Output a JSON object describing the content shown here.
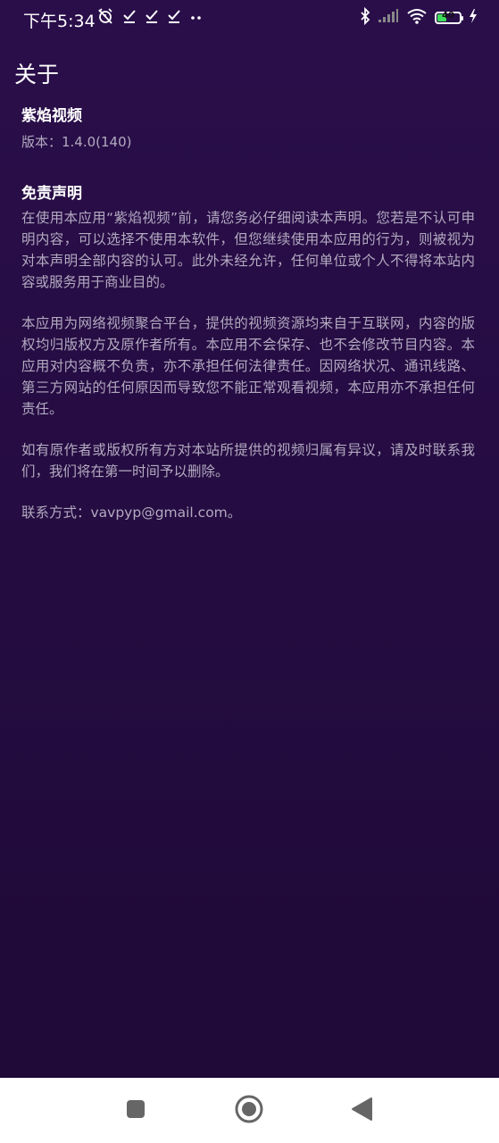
{
  "status_bar": {
    "time": "下午5:34",
    "battery_level": "40",
    "battery_fraction": 0.4,
    "icons_left": [
      "alarm-off-icon",
      "download-done-icon",
      "download-done-icon",
      "download-done-icon",
      "more-dots-icon"
    ],
    "icons_right": [
      "bluetooth-icon",
      "cellular-signal-icon",
      "wifi-icon",
      "battery-icon",
      "charging-icon"
    ]
  },
  "page": {
    "title": "关于",
    "app_name": "紫焰视频",
    "version": "版本：1.4.0(140)",
    "disclaimer_title": "免责声明",
    "paragraphs": [
      "在使用本应用“紫焰视频”前，请您务必仔细阅读本声明。您若是不认可申明内容，可以选择不使用本软件，但您继续使用本应用的行为，则被视为对本声明全部内容的认可。此外未经允许，任何单位或个人不得将本站内容或服务用于商业目的。",
      "本应用为网络视频聚合平台，提供的视频资源均来自于互联网，内容的版权均归版权方及原作者所有。本应用不会保存、也不会修改节目内容。本应用对内容概不负责，亦不承担任何法律责任。因网络状况、通讯线路、第三方网站的任何原因而导致您不能正常观看视频，本应用亦不承担任何责任。",
      "如有原作者或版权所有方对本站所提供的视频归属有异议，请及时联系我们，我们将在第一时间予以删除。",
      "联系方式：vavpyp@gmail.com。"
    ]
  },
  "nav_bar": {
    "buttons": [
      "recents-square-icon",
      "home-circle-icon",
      "back-triangle-icon"
    ]
  },
  "colors": {
    "background_top": "#2a0e4a",
    "background_bottom": "#1f0a38",
    "body_text": "#b3aac0",
    "heading_text": "#ffffff",
    "battery_fill": "#3ddc5a"
  }
}
